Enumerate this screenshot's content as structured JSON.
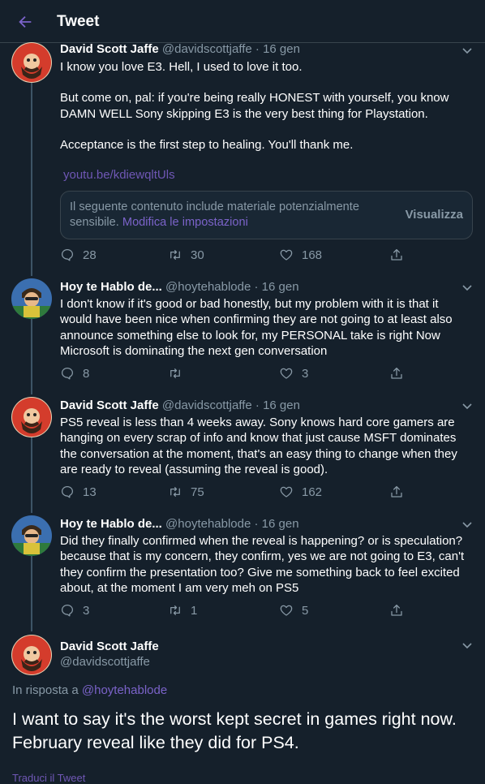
{
  "header": {
    "title": "Tweet"
  },
  "tweets": [
    {
      "name": "David Scott Jaffe",
      "handle": "@davidscottjaffe",
      "date": "· 16 gen",
      "paragraphs": [
        "I know you love E3. Hell, I used to love it too.",
        "But come on, pal: if you're being really HONEST with yourself, you know DAMN WELL Sony skipping E3 is the very best thing for Playstation.",
        "Acceptance is the first step to healing. You'll thank me."
      ],
      "link": "youtu.be/kdiewqltUls",
      "sensitive": {
        "text": "Il seguente contenuto include materiale potenzialmente sensibile.",
        "link": "Modifica le impostazioni",
        "button": "Visualizza"
      },
      "replies": "28",
      "retweets": "30",
      "likes": "168"
    },
    {
      "name": "Hoy te Hablo de...",
      "handle": "@hoytehablode",
      "date": "· 16 gen",
      "text": "I don't know if it's good or bad honestly, but my problem with it is that it would have been nice when confirming they are not going to at least also announce something else to look for, my PERSONAL take is right Now Microsoft is dominating the next gen conversation",
      "replies": "8",
      "retweets": "",
      "likes": "3"
    },
    {
      "name": "David Scott Jaffe",
      "handle": "@davidscottjaffe",
      "date": "· 16 gen",
      "text": "PS5 reveal is less than 4 weeks away. Sony knows hard core gamers are hanging on every scrap of info and know that just cause MSFT dominates the conversation at the moment, that's an easy thing to change when they are ready to reveal (assuming the reveal is good).",
      "replies": "13",
      "retweets": "75",
      "likes": "162"
    },
    {
      "name": "Hoy te Hablo de...",
      "handle": "@hoytehablode",
      "date": "· 16 gen",
      "text": "Did they finally confirmed when the reveal is happening? or is speculation? because that is my concern, they confirm, yes we are not going to E3, can't they confirm the presentation too? Give me something back to feel excited about, at the moment I am very meh on PS5",
      "replies": "3",
      "retweets": "1",
      "likes": "5"
    }
  ],
  "main_tweet": {
    "name": "David Scott Jaffe",
    "handle": "@davidscottjaffe",
    "reply_prefix": "In risposta a ",
    "reply_handle": "@hoytehablode",
    "text": "I want to say it's the worst kept secret in games right now. February reveal like they did for PS4.",
    "translate": "Traduci il Tweet"
  },
  "colors": {
    "background": "#15202b",
    "accent": "#7b63c9",
    "secondary_text": "#8899a6",
    "border": "#38444d"
  }
}
